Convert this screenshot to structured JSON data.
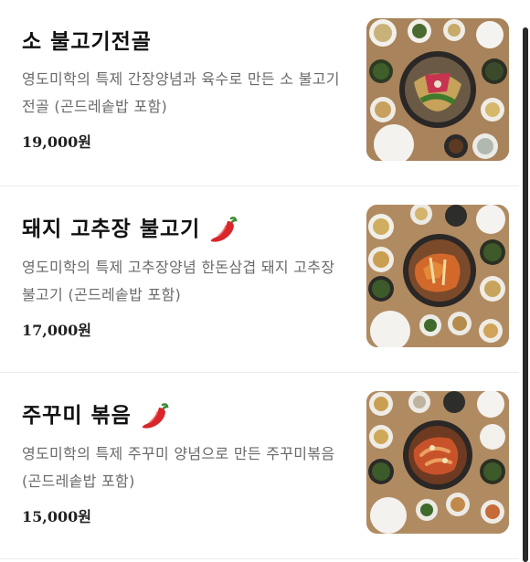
{
  "menu": {
    "items": [
      {
        "name": "소 불고기전골",
        "description": "영도미학의 특제 간장양념과 육수로 만든 소 불고기 전골 (곤드레솥밥 포함)",
        "price": "19,000원",
        "spicy": false,
        "image_icon": "bulgogi-hotpot-photo"
      },
      {
        "name": "돼지 고추장 불고기",
        "description": "영도미학의 특제 고추장양념 한돈삼겹 돼지 고추장 불고기 (곤드레솥밥 포함)",
        "price": "17,000원",
        "spicy": true,
        "image_icon": "pork-bulgogi-photo"
      },
      {
        "name": "주꾸미 볶음",
        "description": "영도미학의 특제 주꾸미 양념으로 만든 주꾸미볶음 (곤드레솥밥 포함)",
        "price": "15,000원",
        "spicy": true,
        "image_icon": "webfoot-octopus-photo"
      }
    ]
  },
  "colors": {
    "pepper_red": "#d8262b",
    "table_wood": "#a88762",
    "scrollbar": "#2a2a2a"
  }
}
